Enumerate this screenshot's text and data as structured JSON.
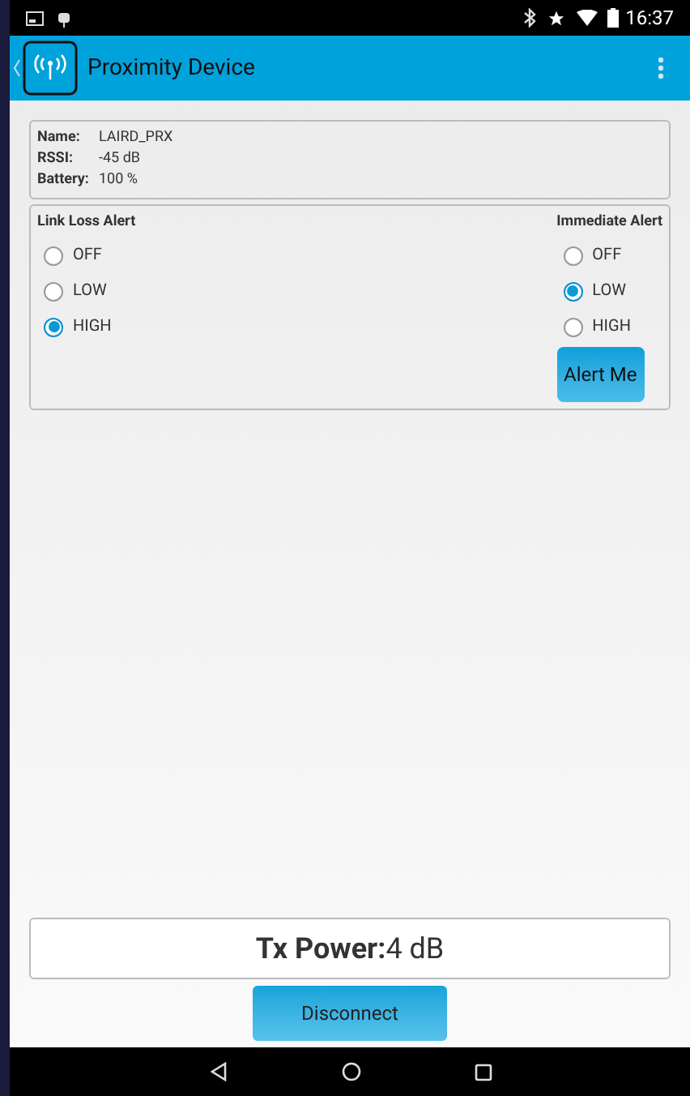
{
  "status_bar": {
    "time": "16:37"
  },
  "app_bar": {
    "title": "Proximity Device"
  },
  "device_info": [
    {
      "label": "Name:",
      "value": "LAIRD_PRX"
    },
    {
      "label": "RSSI:",
      "value": "-45 dB"
    },
    {
      "label": "Battery:",
      "value": "100 %"
    }
  ],
  "link_loss_alert": {
    "title": "Link Loss Alert",
    "options": [
      {
        "label": "OFF",
        "selected": false
      },
      {
        "label": "LOW",
        "selected": false
      },
      {
        "label": "HIGH",
        "selected": true
      }
    ]
  },
  "immediate_alert": {
    "title": "Immediate Alert",
    "options": [
      {
        "label": "OFF",
        "selected": false
      },
      {
        "label": "LOW",
        "selected": true
      },
      {
        "label": "HIGH",
        "selected": false
      }
    ],
    "button": "Alert Me"
  },
  "tx_power": "**Tx Power:**4 dB",
  "disconnect_button": "Disconnect"
}
